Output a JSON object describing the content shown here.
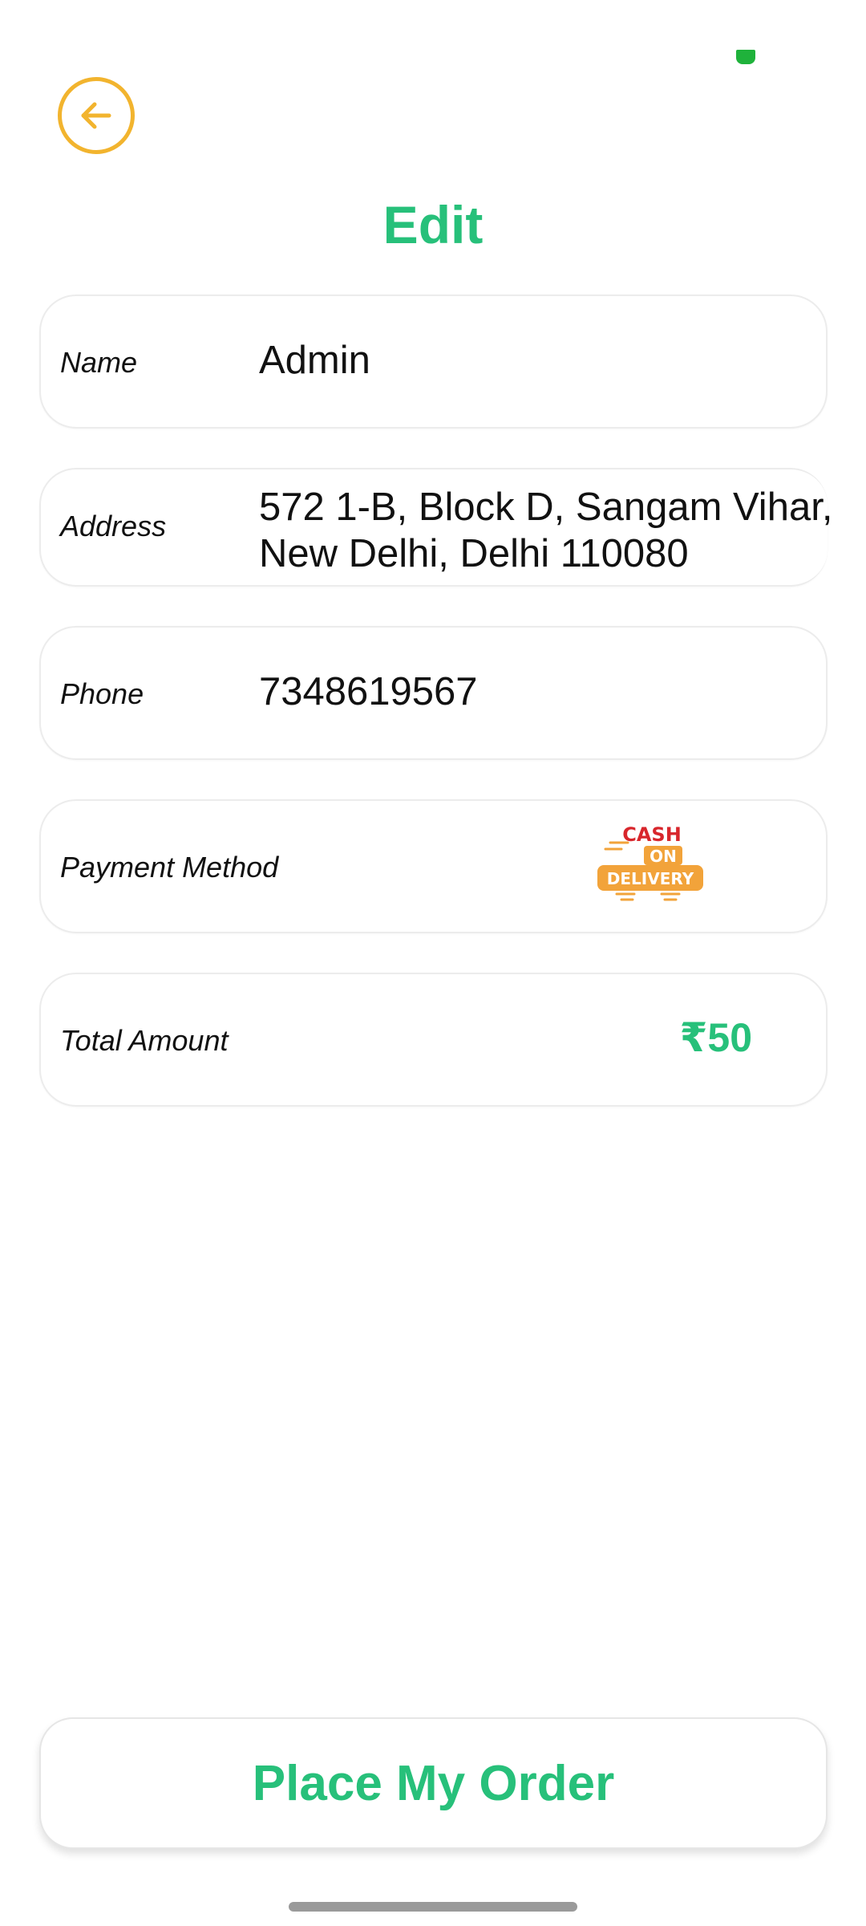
{
  "colors": {
    "accent": "#27c07a",
    "back_icon": "#f2b42e",
    "card_border": "#ececec",
    "status_dot": "#1fb23b"
  },
  "header": {
    "back_icon": "arrow-left-circle-icon",
    "title": "Edit"
  },
  "form": {
    "name": {
      "label": "Name",
      "value": "Admin"
    },
    "address": {
      "label": "Address",
      "lines": [
        "572 1-B, Block D, Sangam Vihar,",
        "New Delhi, Delhi 110080"
      ]
    },
    "phone": {
      "label": "Phone",
      "value": "7348619567"
    },
    "payment": {
      "label": "Payment Method",
      "logo": {
        "icon": "cash-on-delivery-logo",
        "line1": "CASH",
        "line2": "ON",
        "line3": "DELIVERY"
      }
    },
    "total": {
      "label": "Total Amount",
      "value": "₹50"
    }
  },
  "actions": {
    "place_order_label": "Place My Order"
  }
}
